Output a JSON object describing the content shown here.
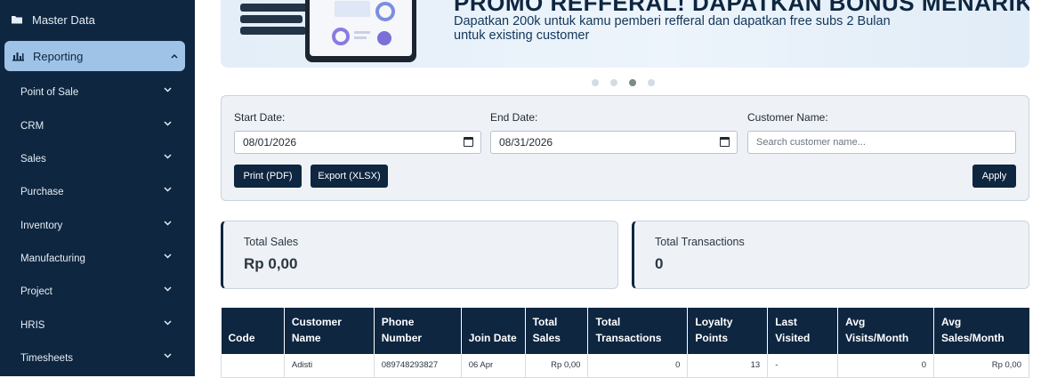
{
  "sidebar": {
    "top_item": "Master Data",
    "active": "Reporting",
    "items": [
      {
        "label": "Point of Sale"
      },
      {
        "label": "CRM"
      },
      {
        "label": "Sales"
      },
      {
        "label": "Purchase"
      },
      {
        "label": "Inventory"
      },
      {
        "label": "Manufacturing"
      },
      {
        "label": "Project"
      },
      {
        "label": "HRIS"
      },
      {
        "label": "Timesheets"
      }
    ]
  },
  "banner": {
    "title": "PROMO REFFERAL! DAPATKAN BONUS MENARIK!",
    "line1": "Dapatkan 200k untuk kamu pemberi refferal dan dapatkan free subs 2 Bulan",
    "line2": "untuk existing customer"
  },
  "carousel": {
    "count": 4,
    "active": 3
  },
  "filters": {
    "start_label": "Start Date:",
    "start_value": "08/01/2026",
    "end_label": "End Date:",
    "end_value": "08/31/2026",
    "customer_label": "Customer Name:",
    "customer_placeholder": "Search customer name...",
    "print_label": "Print (PDF)",
    "export_label": "Export (XLSX)",
    "apply_label": "Apply"
  },
  "stats": {
    "total_sales_label": "Total Sales",
    "total_sales_value": "Rp 0,00",
    "total_tx_label": "Total Transactions",
    "total_tx_value": "0"
  },
  "table": {
    "headers": {
      "code": "Code",
      "customer_name": "Customer Name",
      "phone": "Phone Number",
      "join_date": "Join Date",
      "total_sales": "Total Sales",
      "total_tx": "Total Transactions",
      "loyalty": "Loyalty Points",
      "last_visited": "Last Visited",
      "avg_visits": "Avg Visits/Month",
      "avg_sales": "Avg Sales/Month"
    },
    "rows": [
      {
        "code": "",
        "customer_name": "Adisti",
        "phone": "089748293827",
        "join_date": "06 Apr",
        "total_sales": "Rp 0,00",
        "total_tx": "0",
        "loyalty": "13",
        "last_visited": "-",
        "avg_visits": "0",
        "avg_sales": "Rp 0,00"
      }
    ]
  }
}
